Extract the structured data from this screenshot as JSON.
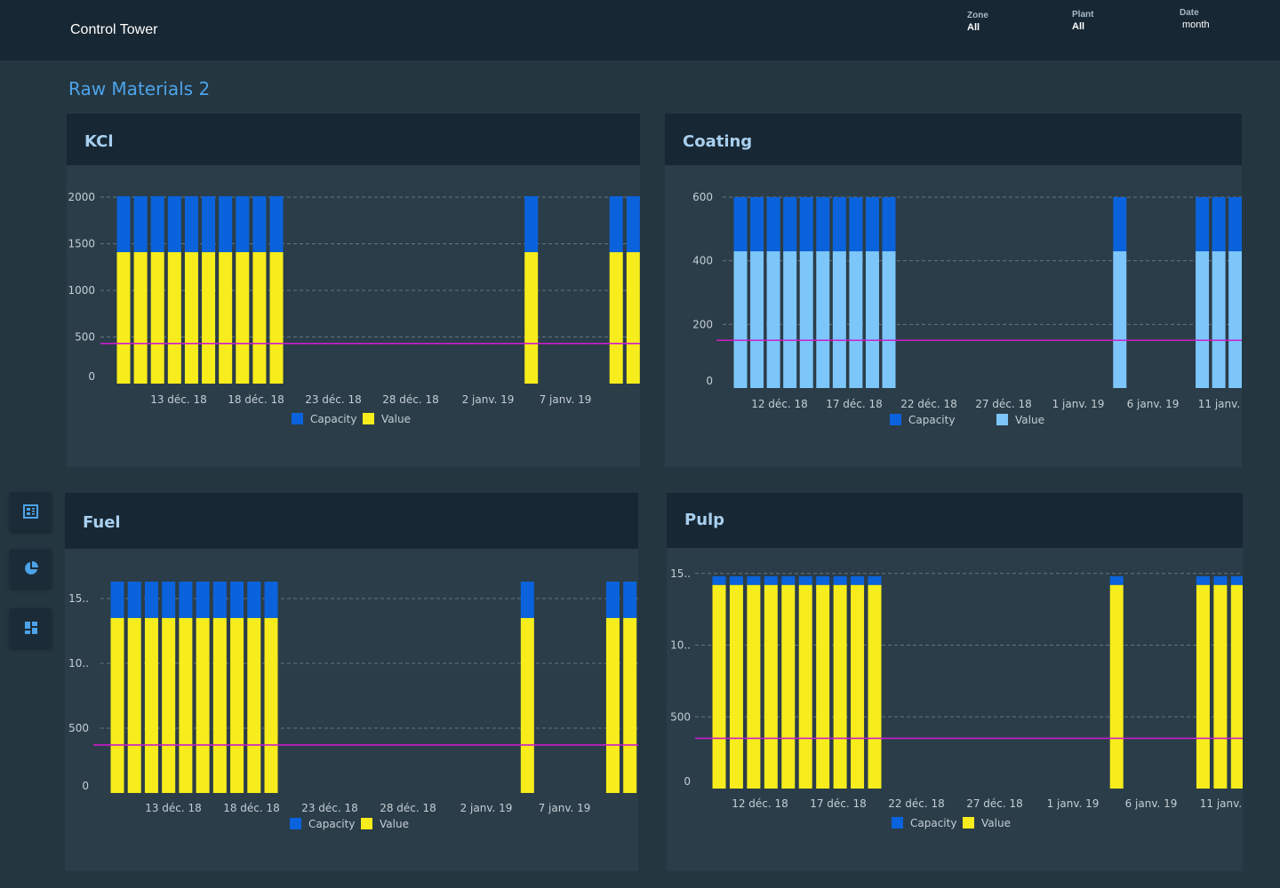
{
  "app": {
    "title": "Control Tower"
  },
  "filters": {
    "zone": {
      "label": "Zone",
      "value": "All"
    },
    "plant": {
      "label": "Plant",
      "value": "All"
    },
    "date": {
      "label": "Date",
      "value": "month"
    }
  },
  "page": {
    "title": "Raw Materials 2"
  },
  "sidebar": [
    {
      "icon": "report-icon"
    },
    {
      "icon": "pie-chart-icon"
    },
    {
      "icon": "dashboard-icon"
    }
  ],
  "colors": {
    "capacity": "#0a63dc",
    "value_yellow": "#f7ec1c",
    "value_lightblue": "#7cc6fa",
    "threshold": "#cc1ccc"
  },
  "chart_data": [
    {
      "panel_title": "KCl",
      "type": "bar",
      "stacked": true,
      "x": [
        "2018-12-11",
        "2018-12-12",
        "2018-12-13",
        "2018-12-14",
        "2018-12-15",
        "2018-12-16",
        "2018-12-17",
        "2018-12-18",
        "2018-12-19",
        "2018-12-20",
        "2019-01-04",
        "2019-01-09",
        "2019-01-10",
        "2019-01-11"
      ],
      "series": [
        {
          "name": "Value",
          "color": "#f7ec1c",
          "values": [
            1410,
            1410,
            1410,
            1410,
            1410,
            1410,
            1410,
            1410,
            1410,
            1410,
            1410,
            1410,
            1410,
            1410
          ]
        },
        {
          "name": "Capacity",
          "color": "#0a63dc",
          "values": [
            600,
            600,
            600,
            600,
            600,
            600,
            600,
            600,
            600,
            600,
            600,
            600,
            600,
            600
          ]
        }
      ],
      "threshold": 430,
      "yticks": [
        "2000",
        "1500",
        "1000",
        "500",
        "0"
      ],
      "ytick_values": [
        2000,
        1500,
        1000,
        500,
        0
      ],
      "xticks": [
        "13 déc. 18",
        "18 déc. 18",
        "23 déc. 18",
        "28 déc. 18",
        "2 janv. 19",
        "7 janv. 19"
      ],
      "ylim": [
        0,
        2000
      ],
      "legend": [
        "Capacity",
        "Value"
      ],
      "grid": true
    },
    {
      "panel_title": "Coating",
      "type": "bar",
      "stacked": true,
      "x": [
        "2018-12-11",
        "2018-12-12",
        "2018-12-13",
        "2018-12-14",
        "2018-12-15",
        "2018-12-16",
        "2018-12-17",
        "2018-12-18",
        "2018-12-19",
        "2018-12-20",
        "2019-01-03",
        "2019-01-08",
        "2019-01-09",
        "2019-01-10"
      ],
      "series": [
        {
          "name": "Value",
          "color": "#7cc6fa",
          "values": [
            430,
            430,
            430,
            430,
            430,
            430,
            430,
            430,
            430,
            430,
            430,
            430,
            430,
            430
          ]
        },
        {
          "name": "Capacity",
          "color": "#0a63dc",
          "values": [
            170,
            170,
            170,
            170,
            170,
            170,
            170,
            170,
            170,
            170,
            170,
            170,
            170,
            170
          ]
        }
      ],
      "threshold": 150,
      "yticks": [
        "600",
        "400",
        "200",
        "0"
      ],
      "ytick_values": [
        600,
        400,
        200,
        0
      ],
      "xticks": [
        "12 déc. 18",
        "17 déc. 18",
        "22 déc. 18",
        "27 déc. 18",
        "1 janv. 19",
        "6 janv. 19",
        "11 janv. 19"
      ],
      "ylim": [
        0,
        600
      ],
      "legend": [
        "Capacity",
        "Value"
      ],
      "grid": true
    },
    {
      "panel_title": "Fuel",
      "type": "bar",
      "stacked": true,
      "x": [
        "2018-12-11",
        "2018-12-12",
        "2018-12-13",
        "2018-12-14",
        "2018-12-15",
        "2018-12-16",
        "2018-12-17",
        "2018-12-18",
        "2018-12-19",
        "2018-12-20",
        "2019-01-04",
        "2019-01-09",
        "2019-01-10",
        "2019-01-11"
      ],
      "series": [
        {
          "name": "Value",
          "color": "#f7ec1c",
          "values": [
            1350,
            1350,
            1350,
            1350,
            1350,
            1350,
            1350,
            1350,
            1350,
            1350,
            1350,
            1350,
            1350,
            1350
          ]
        },
        {
          "name": "Capacity",
          "color": "#0a63dc",
          "values": [
            280,
            280,
            280,
            280,
            280,
            280,
            280,
            280,
            280,
            280,
            280,
            280,
            280,
            280
          ]
        }
      ],
      "threshold": 370,
      "yticks": [
        "15..",
        "10..",
        "500",
        "0"
      ],
      "ytick_values": [
        1500,
        1000,
        500,
        0
      ],
      "xticks": [
        "13 déc. 18",
        "18 déc. 18",
        "23 déc. 18",
        "28 déc. 18",
        "2 janv. 19",
        "7 janv. 19"
      ],
      "ylim": [
        0,
        1630
      ],
      "legend": [
        "Capacity",
        "Value"
      ],
      "grid": true
    },
    {
      "panel_title": "Pulp",
      "type": "bar",
      "stacked": true,
      "x": [
        "2018-12-11",
        "2018-12-12",
        "2018-12-13",
        "2018-12-14",
        "2018-12-15",
        "2018-12-16",
        "2018-12-17",
        "2018-12-18",
        "2018-12-19",
        "2018-12-20",
        "2019-01-03",
        "2019-01-08",
        "2019-01-09",
        "2019-01-10"
      ],
      "series": [
        {
          "name": "Value",
          "color": "#f7ec1c",
          "values": [
            1420,
            1420,
            1420,
            1420,
            1420,
            1420,
            1420,
            1420,
            1420,
            1420,
            1420,
            1420,
            1420,
            1420
          ]
        },
        {
          "name": "Capacity",
          "color": "#0a63dc",
          "values": [
            60,
            60,
            60,
            60,
            60,
            60,
            60,
            60,
            60,
            60,
            60,
            60,
            60,
            60
          ]
        }
      ],
      "threshold": 350,
      "yticks": [
        "15..",
        "10..",
        "500",
        "0"
      ],
      "ytick_values": [
        1500,
        1000,
        500,
        0
      ],
      "xticks": [
        "12 déc. 18",
        "17 déc. 18",
        "22 déc. 18",
        "27 déc. 18",
        "1 janv. 19",
        "6 janv. 19",
        "11 janv. 19"
      ],
      "ylim": [
        0,
        1480
      ],
      "legend": [
        "Capacity",
        "Value"
      ],
      "grid": true
    }
  ]
}
